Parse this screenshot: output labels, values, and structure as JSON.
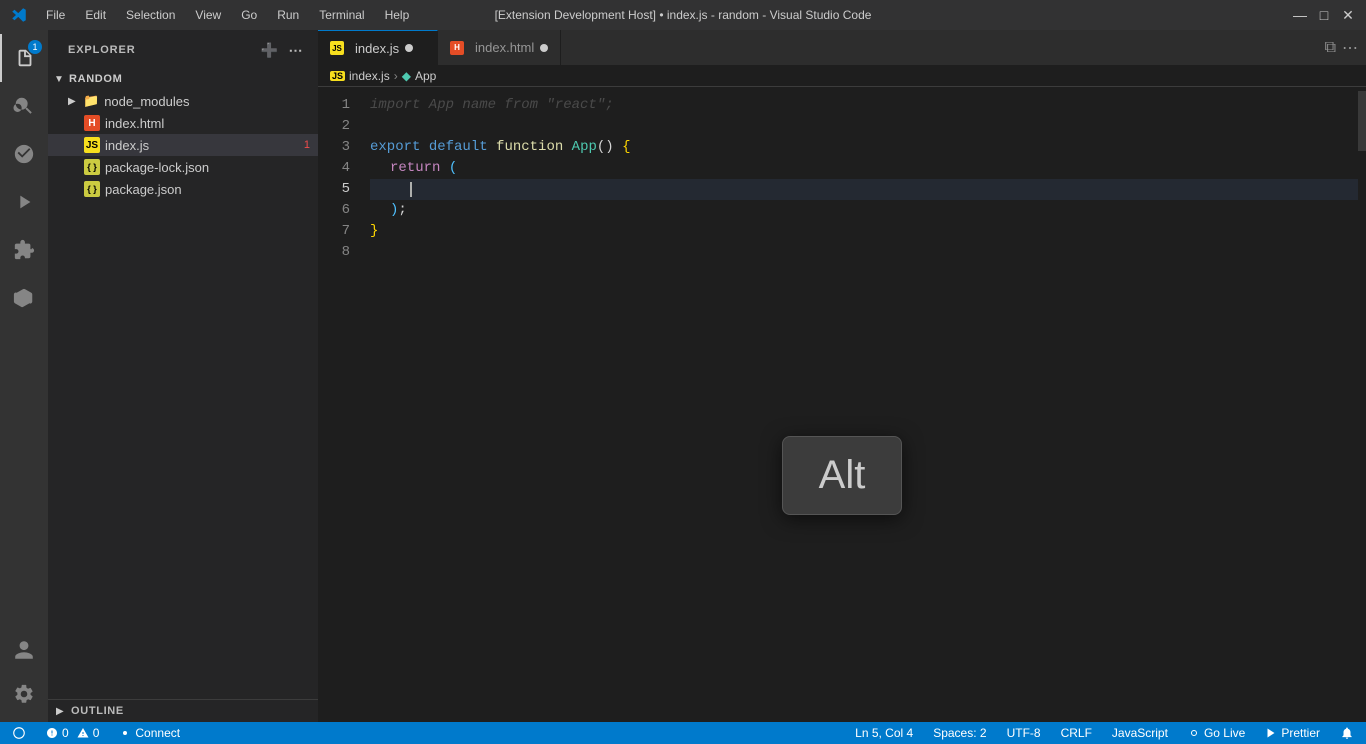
{
  "titleBar": {
    "title": "[Extension Development Host] • index.js - random - Visual Studio Code",
    "menu": [
      "File",
      "Edit",
      "Selection",
      "View",
      "Go",
      "Run",
      "Terminal",
      "Help"
    ]
  },
  "activityBar": {
    "items": [
      {
        "name": "explorer",
        "icon": "📄",
        "active": true,
        "badge": "1"
      },
      {
        "name": "search",
        "icon": "🔍",
        "active": false
      },
      {
        "name": "source-control",
        "icon": "⎇",
        "active": false
      },
      {
        "name": "run-debug",
        "icon": "▶",
        "active": false
      },
      {
        "name": "extensions",
        "icon": "⊞",
        "active": false
      },
      {
        "name": "source-control-bottom",
        "icon": "⌀",
        "active": false
      }
    ],
    "bottomItems": [
      {
        "name": "account",
        "icon": "👤"
      },
      {
        "name": "settings",
        "icon": "⚙"
      }
    ]
  },
  "sidebar": {
    "title": "EXPLORER",
    "project": "RANDOM",
    "files": [
      {
        "name": "node_modules",
        "type": "folder",
        "expanded": true
      },
      {
        "name": "index.html",
        "type": "html",
        "indent": 1
      },
      {
        "name": "index.js",
        "type": "js",
        "indent": 1,
        "active": true,
        "badge": "1"
      },
      {
        "name": "package-lock.json",
        "type": "json",
        "indent": 1
      },
      {
        "name": "package.json",
        "type": "json",
        "indent": 1
      }
    ],
    "outline": "OUTLINE"
  },
  "tabs": [
    {
      "label": "index.js",
      "type": "js",
      "active": true,
      "modified": true
    },
    {
      "label": "index.html",
      "type": "html",
      "active": false,
      "modified": true
    }
  ],
  "breadcrumb": {
    "items": [
      "index.js",
      "App"
    ]
  },
  "editor": {
    "lines": [
      {
        "num": 1,
        "content": "faded_import"
      },
      {
        "num": 2,
        "content": "empty"
      },
      {
        "num": 3,
        "content": "export_default"
      },
      {
        "num": 4,
        "content": "return_line"
      },
      {
        "num": 5,
        "content": "cursor_line"
      },
      {
        "num": 6,
        "content": "close_paren"
      },
      {
        "num": 7,
        "content": "close_brace"
      },
      {
        "num": 8,
        "content": "empty"
      }
    ],
    "cursorLine": 5,
    "cursorCol": 4
  },
  "keyOverlay": {
    "label": "Alt"
  },
  "statusBar": {
    "errors": "0",
    "warnings": "0",
    "branch": "Connect",
    "position": "Ln 5, Col 4",
    "spaces": "Spaces: 2",
    "encoding": "UTF-8",
    "lineEnding": "CRLF",
    "language": "JavaScript",
    "goLive": "Go Live",
    "prettier": "Prettier"
  }
}
